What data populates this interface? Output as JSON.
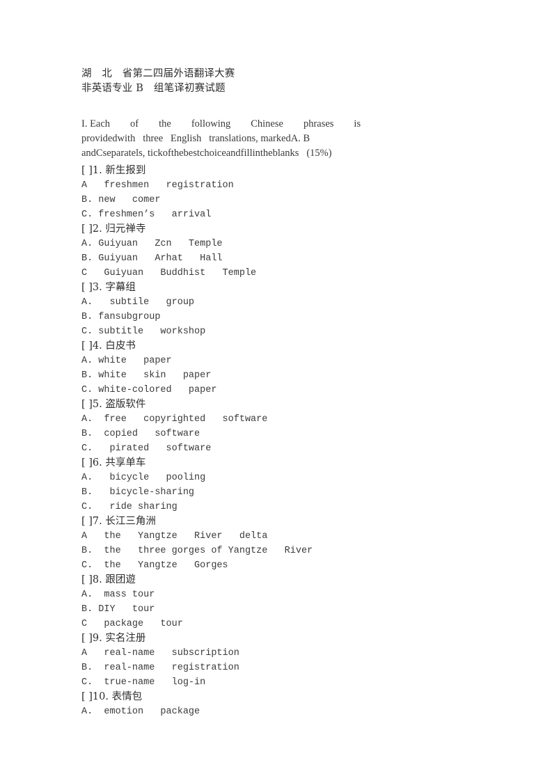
{
  "document": {
    "title_lines": [
      "湖　北　省第二四届外语翻译大赛",
      "非英语专业 B　组笔译初赛试题"
    ],
    "instructions": {
      "line1": "I. Each        of        the        following        Chinese        phrases        is",
      "line2": "providedwith   three   English   translations, markedA. B",
      "line3": "andCseparatels, tickofthebestchoiceandfillintheblanks   (15%)"
    },
    "questions": [
      {
        "stem": "[ ]1. 新生报到",
        "options": [
          "A   freshmen   registration",
          "B. new   comer",
          "C. freshmen’s   arrival"
        ]
      },
      {
        "stem": "[ ]2. 归元禅寺",
        "options": [
          "A. Guiyuan   Zcn   Temple",
          "B. Guiyuan   Arhat   Hall",
          "C   Guiyuan   Buddhist   Temple"
        ]
      },
      {
        "stem": "[ ]3. 字幕组",
        "options": [
          "A.   subtile   group",
          "B. fansubgroup",
          "C. subtitle   workshop"
        ]
      },
      {
        "stem": "[ ]4. 白皮书",
        "options": [
          "A. white   paper",
          "B. white   skin   paper",
          "C. white-colored   paper"
        ]
      },
      {
        "stem": "[ ]5. 盗版软件",
        "options": [
          "A.  free   copyrighted   software",
          "B.  copied   software",
          "C.   pirated   software"
        ]
      },
      {
        "stem": "[ ]6. 共享单车",
        "options": [
          "A.   bicycle   pooling",
          "B.   bicycle-sharing",
          "C.   ride sharing"
        ]
      },
      {
        "stem": "[ ]7. 长江三角洲",
        "options": [
          "A   the   Yangtze   River   delta",
          "B.  the   three gorges of Yangtze   River",
          "C.  the   Yangtze   Gorges"
        ]
      },
      {
        "stem": "[ ]8. 跟团遊",
        "options": [
          "A.  mass tour",
          "B. DIY   tour",
          "C   package   tour"
        ]
      },
      {
        "stem": "[ ]9. 实名注册",
        "options": [
          "A   real-name   subscription",
          "B.  real-name   registration",
          "C.  true-name   log-in"
        ]
      },
      {
        "stem": "[ ]10. 表情包",
        "options": [
          "A.  emotion   package"
        ]
      }
    ]
  }
}
